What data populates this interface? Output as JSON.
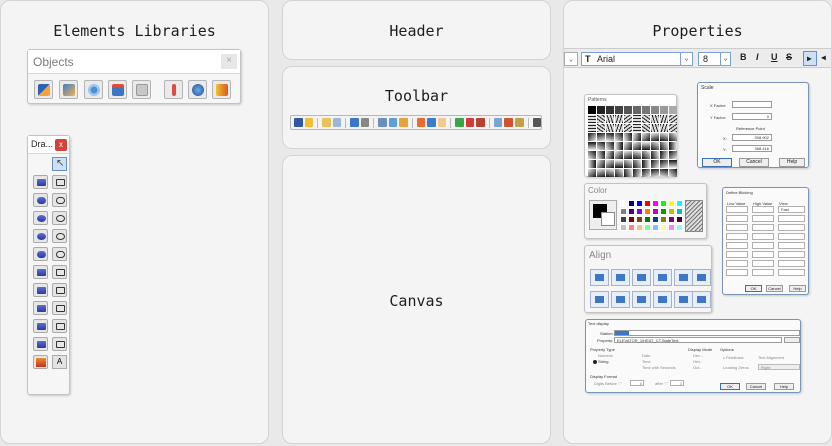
{
  "columns": {
    "elements": "Elements Libraries",
    "header": "Header",
    "toolbar": "Toolbar",
    "canvas": "Canvas",
    "properties": "Properties"
  },
  "objects": {
    "title": "Objects",
    "close": "×"
  },
  "draw": {
    "title": "Dra...",
    "close": "x",
    "text_tool": "A"
  },
  "props": {
    "font": "Arial",
    "size": "8",
    "bold": "B",
    "italic": "I",
    "underline": "U",
    "strike": "S",
    "font_icon": "T"
  },
  "patterns": {
    "title": "Patterns"
  },
  "color": {
    "title": "Color"
  },
  "align": {
    "title": "Align"
  },
  "scale": {
    "title": "Scale",
    "x_factor": "X Factor:",
    "y_factor": "Y Factor:",
    "y_value": "0",
    "ref_point": "Reference Point",
    "x": "X:",
    "x_value": "308.902",
    "y": "Y:",
    "y_value2": "368.416",
    "ok": "OK",
    "cancel": "Cancel",
    "help": "Help"
  },
  "blink": {
    "title": "Define Blinking",
    "low": "Low Value",
    "high": "High Value",
    "view": "View",
    "view_value": "Fast",
    "ok": "OK",
    "cancel": "Cancel",
    "help": "Help"
  },
  "text_display": {
    "title": "Text display",
    "station": "Station:",
    "property": "Property:",
    "property_value": "ELEVATOR_1\\HEAT_CT.StateText",
    "property_type": "Property Type",
    "numeric": "Numeric",
    "string": "String",
    "date": "Date",
    "time": "Time",
    "time_seconds": "Time with Seconds",
    "display_mode": "Display Mode",
    "dec": "Dec...",
    "hex": "Hex...",
    "oct": "Oct...",
    "options": "Options",
    "c_feedback": "c Feedback",
    "leading_zeros": "Leading Zeros",
    "text_alignment": "Text Alignment",
    "right": "Right",
    "display_format": "Display Format",
    "digits_before": "Digits Before \".\"",
    "after": "after \".\"",
    "before_value": "6",
    "after_value": "3",
    "ok": "OK",
    "cancel": "Cancel",
    "help": "Help"
  }
}
